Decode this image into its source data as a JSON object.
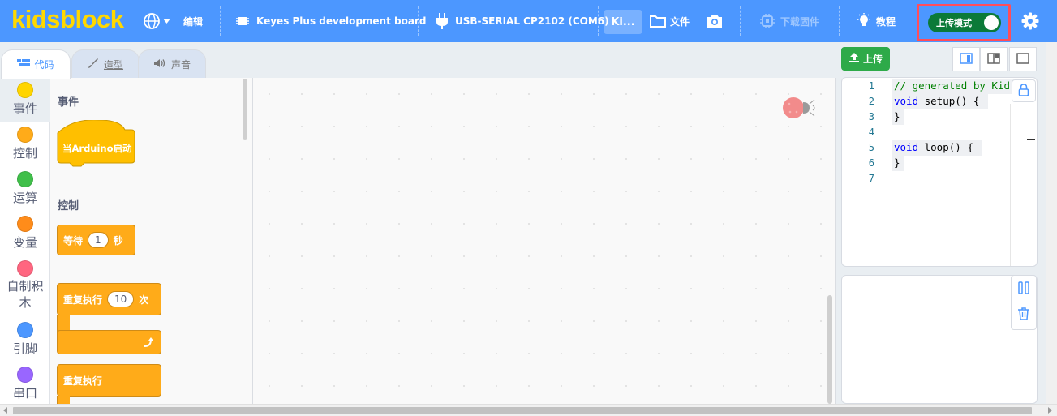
{
  "menu": {
    "logo": "kidsblock",
    "edit_label": "编辑",
    "board_label": "Keyes Plus development board",
    "port_label": "USB-SERIAL CP2102 (COM6)",
    "project_title": "Ki...",
    "file_label": "文件",
    "firmware_label": "下载固件",
    "tutorial_label": "教程",
    "upload_mode_label": "上传模式",
    "upload_mode_on": true
  },
  "tabs": [
    {
      "label": "代码",
      "icon": "code-icon"
    },
    {
      "label": "造型",
      "icon": "brush-icon"
    },
    {
      "label": "声音",
      "icon": "speaker-icon"
    }
  ],
  "categories": [
    {
      "label": "事件",
      "color": "#ffd500"
    },
    {
      "label": "控制",
      "color": "#ffab19"
    },
    {
      "label": "运算",
      "color": "#40bf4a"
    },
    {
      "label": "变量",
      "color": "#ff8c1a"
    },
    {
      "label": "自制积木",
      "color": "#ff6680"
    },
    {
      "label": "引脚",
      "color": "#4c97ff"
    },
    {
      "label": "串口",
      "color": "#9966ff"
    }
  ],
  "palette": {
    "events_heading": "事件",
    "when_arduino_starts": "当Arduino启动",
    "control_heading": "控制",
    "wait_prefix": "等待",
    "wait_value": "1",
    "wait_suffix": "秒",
    "repeat_prefix": "重复执行",
    "repeat_value": "10",
    "repeat_suffix": "次",
    "forever": "重复执行"
  },
  "code_panel": {
    "upload_label": "上传",
    "lines": [
      {
        "n": "1",
        "text": "// generated by Kid"
      },
      {
        "n": "2",
        "text": "void setup() {"
      },
      {
        "n": "3",
        "text": "}"
      },
      {
        "n": "4",
        "text": ""
      },
      {
        "n": "5",
        "text": "void loop() {"
      },
      {
        "n": "6",
        "text": "}"
      },
      {
        "n": "7",
        "text": ""
      }
    ]
  },
  "colors": {
    "menubar": "#4c97ff",
    "logo": "#ffd800",
    "upload_button": "#2eaa49",
    "toggle_on": "#0b7a38",
    "highlight_frame": "#ff4d5a"
  }
}
